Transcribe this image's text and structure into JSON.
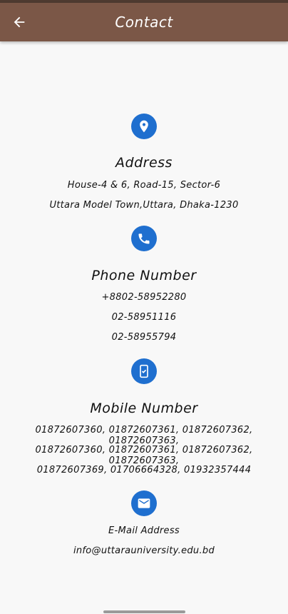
{
  "appbar": {
    "title": "Contact",
    "back_icon": "arrow-left-icon"
  },
  "colors": {
    "appbar": "#7b5747",
    "status_strip": "#4e3a30",
    "icon_circle": "#1f6fcf",
    "background": "#f8f8f8"
  },
  "address": {
    "icon": "location-pin-icon",
    "heading": "Address",
    "lines": [
      "House-4 & 6, Road-15, Sector-6",
      "Uttara Model Town,Uttara, Dhaka-1230"
    ]
  },
  "phone": {
    "icon": "phone-icon",
    "heading": "Phone Number",
    "lines": [
      "+8802-58952280",
      "02-58951116",
      "02-58955794"
    ]
  },
  "mobile": {
    "icon": "mobile-phone-icon",
    "heading": "Mobile Number",
    "lines": [
      "01872607360, 01872607361, 01872607362, 01872607363,",
      "01872607360, 01872607361, 01872607362, 01872607363,",
      "01872607369, 01706664328, 01932357444"
    ]
  },
  "email": {
    "icon": "mail-icon",
    "heading": "E-Mail Address",
    "lines": [
      "info@uttarauniversity.edu.bd"
    ]
  }
}
